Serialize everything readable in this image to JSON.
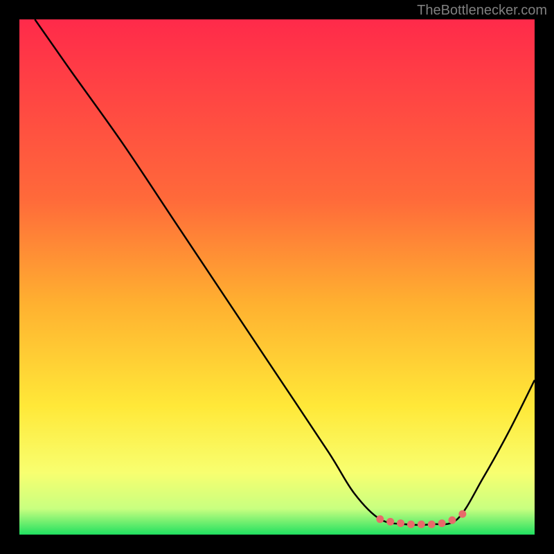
{
  "watermark": "TheBottlenecker.com",
  "chart_data": {
    "type": "line",
    "title": "",
    "xlabel": "",
    "ylabel": "",
    "xlim": [
      0,
      100
    ],
    "ylim": [
      0,
      100
    ],
    "gradient_stops": [
      {
        "offset": 0,
        "color": "#ff2a4a"
      },
      {
        "offset": 35,
        "color": "#ff6a3a"
      },
      {
        "offset": 55,
        "color": "#ffb030"
      },
      {
        "offset": 75,
        "color": "#ffe838"
      },
      {
        "offset": 88,
        "color": "#f8ff70"
      },
      {
        "offset": 95,
        "color": "#c8ff80"
      },
      {
        "offset": 100,
        "color": "#20e060"
      }
    ],
    "curve": [
      {
        "x": 3,
        "y": 100
      },
      {
        "x": 10,
        "y": 90
      },
      {
        "x": 20,
        "y": 76
      },
      {
        "x": 30,
        "y": 61
      },
      {
        "x": 40,
        "y": 46
      },
      {
        "x": 50,
        "y": 31
      },
      {
        "x": 60,
        "y": 16
      },
      {
        "x": 65,
        "y": 8
      },
      {
        "x": 70,
        "y": 3
      },
      {
        "x": 75,
        "y": 2
      },
      {
        "x": 80,
        "y": 2
      },
      {
        "x": 85,
        "y": 3
      },
      {
        "x": 90,
        "y": 11
      },
      {
        "x": 95,
        "y": 20
      },
      {
        "x": 100,
        "y": 30
      }
    ],
    "markers": [
      {
        "x": 70,
        "y": 3
      },
      {
        "x": 72,
        "y": 2.5
      },
      {
        "x": 74,
        "y": 2.2
      },
      {
        "x": 76,
        "y": 2
      },
      {
        "x": 78,
        "y": 2
      },
      {
        "x": 80,
        "y": 2
      },
      {
        "x": 82,
        "y": 2.2
      },
      {
        "x": 84,
        "y": 2.8
      },
      {
        "x": 86,
        "y": 4
      }
    ],
    "marker_color": "#e86a6a"
  }
}
